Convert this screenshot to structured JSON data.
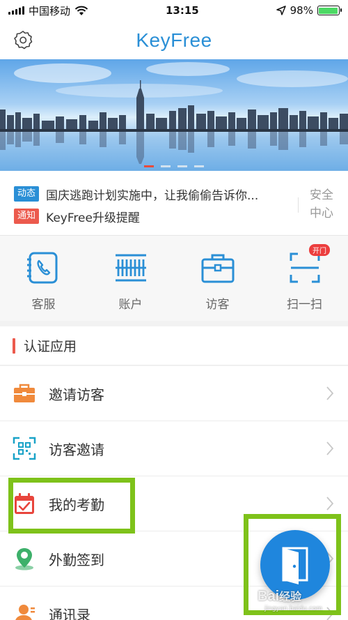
{
  "status_bar": {
    "carrier": "中国移动",
    "time": "13:15",
    "battery_percent": "98%",
    "battery_level": 0.98,
    "wifi_icon": "wifi-icon",
    "location_icon": "location-arrow-icon"
  },
  "navbar": {
    "title": "KeyFree",
    "settings_icon": "gear-icon"
  },
  "banner": {
    "slides": 4,
    "active_index": 0
  },
  "notice": {
    "items": [
      {
        "tag": "动态",
        "text": "国庆逃跑计划实施中，让我偷偷告诉你..."
      },
      {
        "tag": "通知",
        "text": "KeyFree升级提醒"
      }
    ],
    "safety_center": "安全中心"
  },
  "quick_actions": [
    {
      "label": "客服",
      "icon": "phone-icon"
    },
    {
      "label": "账户",
      "icon": "barcode-icon"
    },
    {
      "label": "访客",
      "icon": "briefcase-icon"
    },
    {
      "label": "扫一扫",
      "icon": "scan-icon",
      "badge": "开门"
    }
  ],
  "section": {
    "title": "认证应用"
  },
  "list": [
    {
      "label": "邀请访客",
      "icon": "briefcase-icon"
    },
    {
      "label": "访客邀请",
      "icon": "qr-code-icon"
    },
    {
      "label": "我的考勤",
      "icon": "calendar-check-icon"
    },
    {
      "label": "外勤签到",
      "icon": "map-pin-icon"
    },
    {
      "label": "通讯录",
      "icon": "contacts-icon"
    }
  ],
  "fab": {
    "icon": "door-icon"
  },
  "watermark": {
    "text": "Bai",
    "cn": "经验",
    "sub": "jingyan.baidu.com"
  },
  "colors": {
    "brand": "#2a8fd6",
    "accent_red": "#ec5a4d",
    "highlight": "#7ec21a",
    "battery": "#4cd964"
  }
}
